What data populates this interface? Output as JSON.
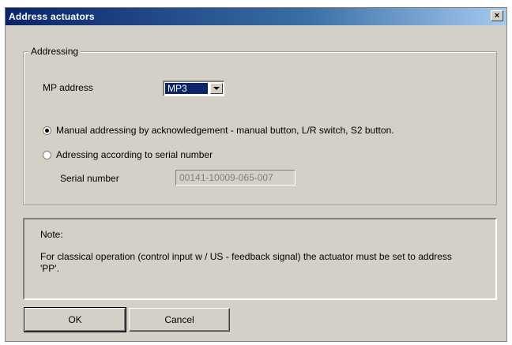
{
  "window": {
    "title": "Address actuators",
    "close_glyph": "×"
  },
  "addressing": {
    "group_label": "Addressing",
    "mp_address_label": "MP address",
    "mp_address_value": "MP3",
    "radio_manual_label": "Manual addressing by acknowledgement - manual button, L/R switch, S2 button.",
    "radio_manual_checked": true,
    "radio_serial_label": "Adressing according to serial number",
    "radio_serial_checked": false,
    "serial_number_label": "Serial number",
    "serial_number_value": "00141-10009-065-007"
  },
  "note": {
    "title": "Note:",
    "text": "For classical operation (control input w / US - feedback signal) the actuator must be set to address 'PP'."
  },
  "buttons": {
    "ok_label": "OK",
    "cancel_label": "Cancel"
  }
}
